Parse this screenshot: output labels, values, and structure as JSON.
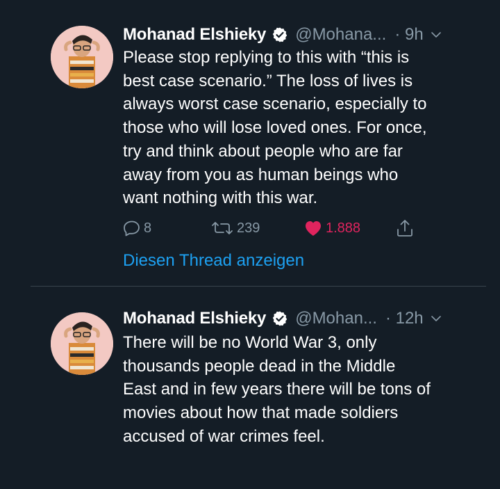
{
  "tweets": [
    {
      "author_name": "Mohanad Elshieky",
      "handle": "@Mohana...",
      "time": "· 9h",
      "verified": true,
      "text_lines": [
        "Please stop replying to this with “this is",
        "best case scenario.” The loss of lives is",
        "always worst case scenario, especially to",
        "those who will lose loved ones. For once,",
        "try and think about people who are far",
        "away from you as human beings who",
        "want nothing with this war."
      ],
      "replies": "8",
      "retweets": "239",
      "likes": "1.888",
      "liked": true,
      "thread_link": "Diesen Thread anzeigen"
    },
    {
      "author_name": "Mohanad Elshieky",
      "handle": "@Mohan...",
      "time": "· 12h",
      "verified": true,
      "text_lines": [
        "There will be no World War 3, only",
        "thousands people dead in the Middle",
        "East and in few years there will be tons of",
        "movies about how that made soldiers",
        "accused of war crimes feel."
      ]
    }
  ],
  "colors": {
    "background": "#141d26",
    "text_primary": "#ffffff",
    "text_secondary": "#8899a6",
    "link": "#1da1f2",
    "like": "#e0245e",
    "divider": "#38444d"
  },
  "icons": {
    "verified": "verified-badge-icon",
    "caret": "chevron-down-icon",
    "reply": "reply-icon",
    "retweet": "retweet-icon",
    "like": "heart-icon",
    "share": "share-icon"
  }
}
